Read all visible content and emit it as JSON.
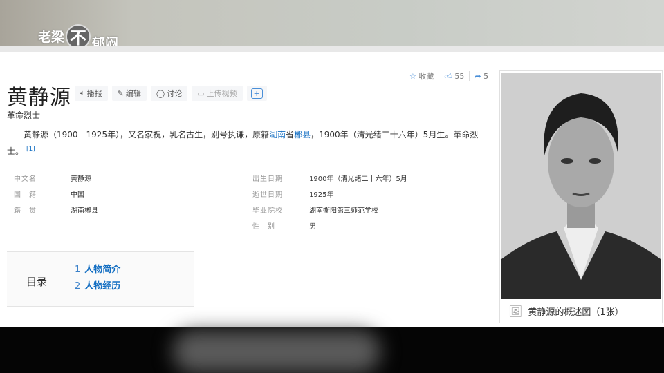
{
  "overlay": {
    "logo_text_a": "老梁",
    "logo_text_b": "不",
    "logo_text_c": "郁闷"
  },
  "header": {
    "title": "黄静源",
    "subtitle": "革命烈士"
  },
  "tools": {
    "broadcast": "播报",
    "edit": "编辑",
    "discuss": "讨论",
    "upload_video": "上传视频",
    "add": "+"
  },
  "actions": {
    "favorite": "收藏",
    "likes": "55",
    "shares": "5"
  },
  "summary": {
    "part1": "黄静源（1900—1925年），又名家祝，乳名古生，别号执谦，原籍",
    "link1": "湖南",
    "part2": "省",
    "link2": "郴县",
    "part3": "，1900年（清光绪二十六年）5月生。革命烈士。",
    "ref": "[1]"
  },
  "info_left": [
    {
      "k": "中文名",
      "v": "黄静源"
    },
    {
      "k": "国　籍",
      "v": "中国"
    },
    {
      "k": "籍　贯",
      "v": "湖南郴县"
    }
  ],
  "info_right": [
    {
      "k": "出生日期",
      "v": "1900年（清光绪二十六年）5月"
    },
    {
      "k": "逝世日期",
      "v": "1925年"
    },
    {
      "k": "毕业院校",
      "v": "湖南衡阳第三师范学校"
    },
    {
      "k": "性　别",
      "v": "男"
    }
  ],
  "toc": {
    "heading": "目录",
    "items": [
      {
        "n": "1",
        "t": "人物简介"
      },
      {
        "n": "2",
        "t": "人物经历"
      }
    ]
  },
  "photo": {
    "caption": "黄静源的概述图（1张）"
  },
  "colors": {
    "link": "#136ec2"
  }
}
